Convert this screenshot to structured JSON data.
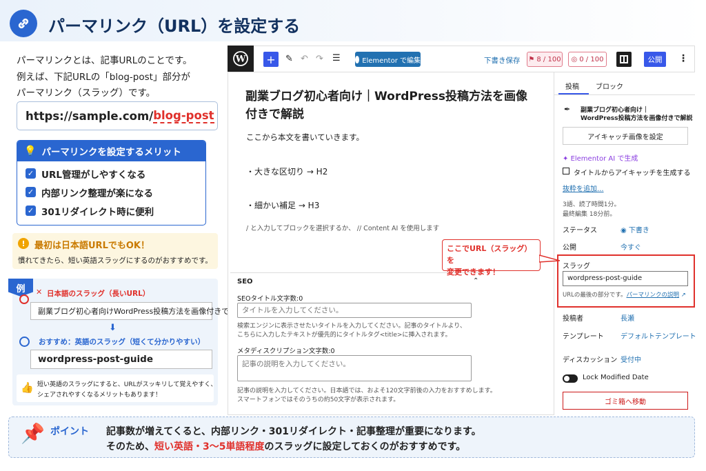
{
  "header": {
    "title": "パーマリンク（URL）を設定する"
  },
  "left": {
    "intro": [
      "パーマリンクとは、記事URLのことです。",
      "例えば、下記URLの「blog-post」部分が",
      "パーマリンク（スラッグ）です。"
    ],
    "url_base": "https://sample.com/",
    "url_slug": "blog-post",
    "merit_title": "パーマリンクを設定するメリット",
    "merits": [
      "URL管理がしやすくなる",
      "内部リンク整理が楽になる",
      "301リダイレクト時に便利"
    ],
    "ok_title": "最初は日本語URLでもOK！",
    "ok_text": "慣れてきたら、短い英語スラッグにするのがおすすめです。",
    "example_tag": "例",
    "bad_label": "日本語のスラッグ（長いURL）",
    "bad_value": "副業ブログ初心者向けWordPress投稿方法を画像付きで解説",
    "good_label": "おすすめ：英語のスラッグ（短くて分かりやすい）",
    "good_value": "wordpress-post-guide",
    "tip": [
      "短い英語のスラッグにすると、URLがスッキリして覚えやすく、",
      "シェアされやすくなるメリットもあります！"
    ]
  },
  "toolbar": {
    "elementor": "Elementor で編集",
    "draft_save": "下書き保存",
    "score1": "8 / 100",
    "score2": "0 / 100",
    "publish": "公開"
  },
  "editor": {
    "title": "副業ブログ初心者向け｜WordPress投稿方法を画像付きで解説",
    "body": "ここから本文を書いていきます。",
    "h2": "・大きな区切り → H2",
    "h3": "・細かい補足 → H3",
    "hint": "/ と入力してブロックを選択するか、 // Content AI を使用します"
  },
  "seo": {
    "header": "SEO",
    "title_label": "SEOタイトル文字数:0",
    "title_placeholder": "タイトルを入力してください。",
    "title_help": [
      "検索エンジンに表示させたいタイトルを入力してください。記事のタイトルより、",
      "こちらに入力したテキストが優先的にタイトルタグ<title>に挿入されます。"
    ],
    "desc_label": "メタディスクリプション文字数:0",
    "desc_placeholder": "記事の説明を入力してください。",
    "desc_help": [
      "記事の説明を入力してください。日本語では、およそ120文字前後の入力をおすすめします。",
      "スマートフォンではそのうちの約50文字が表示されます。"
    ]
  },
  "sidebar": {
    "tab_post": "投稿",
    "tab_block": "ブロック",
    "post_title": [
      "副業ブログ初心者向け｜",
      "WordPress投稿方法を画像付きで解説"
    ],
    "featured_btn": "アイキャッチ画像を設定",
    "elementor_ai": "Elementor AI で生成",
    "gen_checkbox": "タイトルからアイキャッチを生成する",
    "excerpt": "抜粋を追加...",
    "meta": [
      "3語、読了時間1分。",
      "最終編集 18分前。"
    ],
    "status_label": "ステータス",
    "status_value": "下書き",
    "publish_label": "公開",
    "publish_value": "今すぐ",
    "slug_label": "スラッグ",
    "slug_value": "wordpress-post-guide",
    "slug_help": "URLの最後の部分です。",
    "slug_help_link": "パーマリンクの説明",
    "author_label": "投稿者",
    "author_value": "長瀬",
    "template_label": "テンプレート",
    "template_value": "デフォルトテンプレート",
    "discussion_label": "ディスカッション",
    "discussion_value": "受付中",
    "lock_label": "Lock Modified Date",
    "trash": "ゴミ箱へ移動"
  },
  "callout": [
    "ここでURL（スラッグ）を",
    "変更できます！"
  ],
  "point": {
    "label": "ポイント",
    "line1": "記事数が増えてくると、内部リンク・301リダイレクト・記事整理が重要になります。",
    "line2_pre": "そのため、",
    "line2_hl": "短い英語・3〜5単語程度",
    "line2_post": "のスラッグに設定しておくのがおすすめです。"
  },
  "colors": {
    "accent": "#2a66d0",
    "alert": "#e0302b",
    "wp_blue": "#3858e9"
  }
}
